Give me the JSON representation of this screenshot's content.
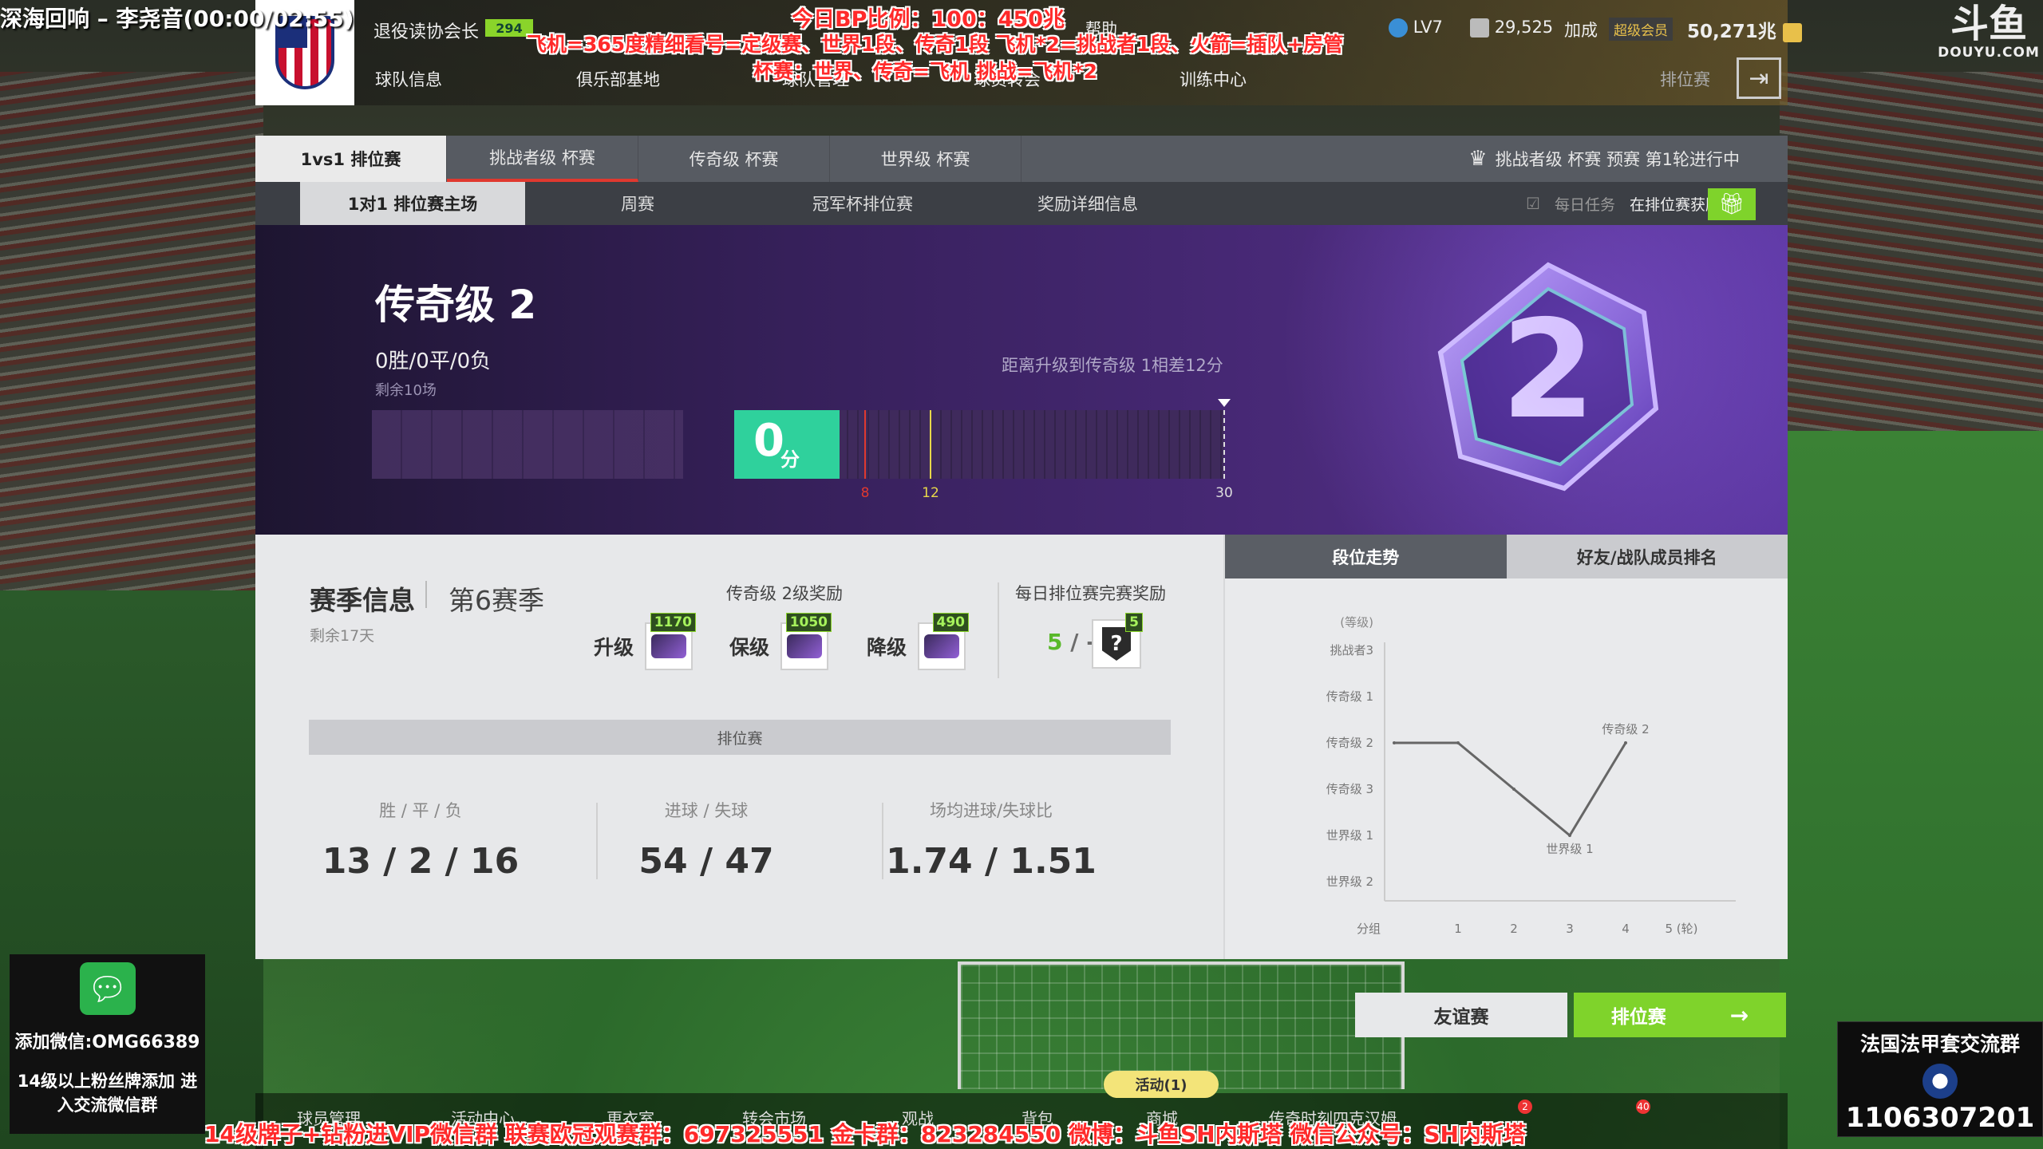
{
  "overlay": {
    "stream_title": "深海回响 – 李尧音(00:00/02:55)",
    "bp_ratio": "今日BP比例：100：450兆",
    "line2": "飞机=365度精细看号=定级赛、世界1段、传奇1段 飞机*2=挑战者1段、火箭=插队+房管",
    "line3": "杯赛：世界、传奇=飞机 挑战=飞机*2",
    "bottom_banner": "14级牌子+钻粉进VIP微信群 联赛欧冠观赛群：697325551 金卡群：823284550 微博：斗鱼SH内斯塔 微信公众号：SH内斯塔",
    "douyu_logo": "斗鱼",
    "douyu_domain": "DOUYU.COM",
    "wechat_add": "添加微信:OMG66389",
    "wechat_note": "14级以上粉丝牌添加 进入交流微信群",
    "group_title": "法国法甲套交流群",
    "group_number": "1106307201"
  },
  "header": {
    "role": "退役读协会长",
    "level_value": "294",
    "nav": [
      "球队信息",
      "俱乐部基地",
      "球队管理",
      "球员转会",
      "训练中心"
    ],
    "help": "帮助",
    "level": "LV7",
    "coins": "29,525",
    "join": "加成",
    "membership": "超级会员",
    "bp": "50,271兆",
    "rank_shortcut": "排位赛"
  },
  "tabs_main": [
    {
      "label": "1vs1 排位赛",
      "active": true
    },
    {
      "label": "挑战者级 杯赛",
      "active": false
    },
    {
      "label": "传奇级 杯赛",
      "active": false
    },
    {
      "label": "世界级 杯赛",
      "active": false
    }
  ],
  "tabs_main_notice": "挑战者级 杯赛 预赛 第1轮进行中",
  "tabs_sub": [
    {
      "label": "1对1 排位赛主场",
      "active": true
    },
    {
      "label": "周赛",
      "active": false
    },
    {
      "label": "冠军杯排位赛",
      "active": false
    },
    {
      "label": "奖励详细信息",
      "active": false
    }
  ],
  "daily_task": "每日任务",
  "daily_task_detail": "在排位赛获胜",
  "hero": {
    "rank": "传奇级 2",
    "record": "0胜/0平/0负",
    "remaining_games": "剩余10场",
    "upgrade_hint": "距离升级到传奇级 1相差12分",
    "score": "0",
    "score_unit": "分",
    "score_fraction": 0,
    "marks": [
      {
        "label": "8",
        "value": 8,
        "color": "#e0392f"
      },
      {
        "label": "12",
        "value": 12,
        "color": "#e8d84a"
      },
      {
        "label": "30",
        "value": 30,
        "color": "#dddddd"
      }
    ],
    "badge_number": "2"
  },
  "season": {
    "title": "赛季信息",
    "season": "第6赛季",
    "days_left": "剩余17天",
    "reward_title": "传奇级 2级奖励",
    "rewards": [
      {
        "name": "升级",
        "value": "1170"
      },
      {
        "name": "保级",
        "value": "1050"
      },
      {
        "name": "降级",
        "value": "490"
      }
    ],
    "daily_title": "每日排位赛完赛奖励",
    "daily_done": "5",
    "daily_sep": "/ -",
    "daily_box_count": "5",
    "daily_box_symbol": "?"
  },
  "ranked_strip": "排位赛",
  "stats": [
    {
      "label": "胜 / 平 / 负",
      "value": "13 / 2 / 16"
    },
    {
      "label": "进球 / 失球",
      "value": "54 / 47"
    },
    {
      "label": "场均进球/失球比",
      "value": "1.74 / 1.51"
    }
  ],
  "chart_tabs": [
    "段位走势",
    "好友/战队成员排名"
  ],
  "chart_data": {
    "type": "line",
    "ylabel": "(等级)",
    "y_categories": [
      "挑战者3",
      "传奇级 1",
      "传奇级 2",
      "传奇级 3",
      "世界级 1",
      "世界级 2"
    ],
    "x": [
      "分组",
      "1",
      "2",
      "3",
      "4",
      "5 (轮)"
    ],
    "values": [
      "传奇级 2",
      "传奇级 2",
      "传奇级 3",
      "世界级 1",
      "传奇级 2"
    ],
    "point_labels": [
      {
        "index": 3,
        "text": "世界级 1"
      },
      {
        "index": 4,
        "text": "传奇级 2"
      }
    ],
    "line_color": "#666666"
  },
  "buttons": {
    "friendly": "友谊赛",
    "ranked": "排位赛",
    "ranked_arrow": "→"
  },
  "bottom_nav": [
    "球员管理",
    "活动中心",
    "更衣室",
    "转会市场",
    "观战",
    "背包",
    "商城",
    "传奇时刻四克汉姆"
  ],
  "activity_pill": "活动(1)",
  "badges": {
    "bag": "2",
    "shop": "40"
  }
}
